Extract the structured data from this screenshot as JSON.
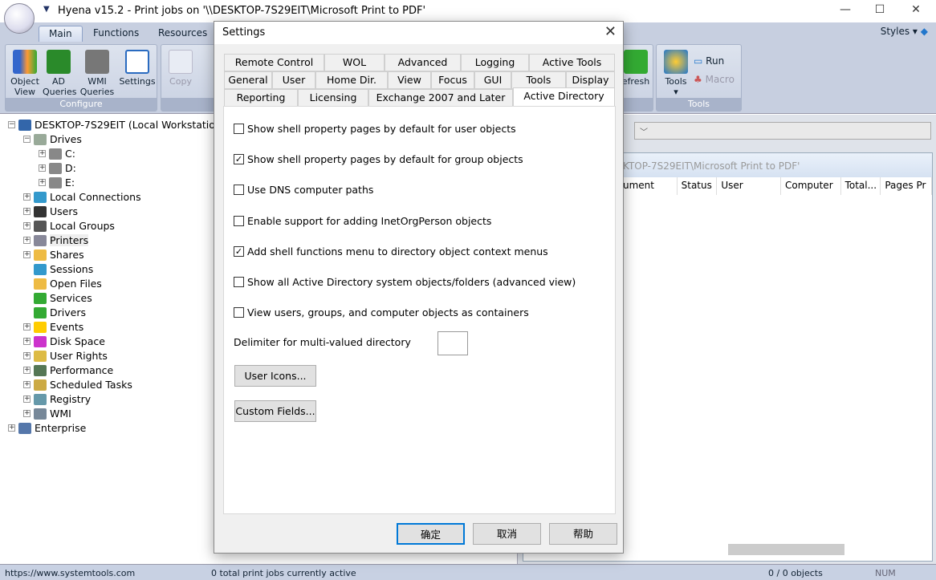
{
  "app": {
    "title": "Hyena v15.2 - Print jobs on '\\\\DESKTOP-7S29EIT\\Microsoft Print to PDF'",
    "styles_label": "Styles"
  },
  "ribbon": {
    "tabs": [
      "Main",
      "Functions",
      "Resources"
    ],
    "configure": {
      "label": "Configure",
      "buttons": [
        "Object View",
        "AD Queries",
        "WMI Queries",
        "Settings"
      ]
    },
    "copy_label": "Copy",
    "refresh_label": "efresh",
    "tools": {
      "label": "Tools",
      "tools_btn": "Tools",
      "run": "Run",
      "macro": "Macro"
    }
  },
  "tree": {
    "root": "DESKTOP-7S29EIT (Local Workstation)",
    "items": [
      {
        "label": "Drives",
        "level": 1,
        "exp": "-"
      },
      {
        "label": "C:",
        "level": 2,
        "exp": "+"
      },
      {
        "label": "D:",
        "level": 2,
        "exp": "+"
      },
      {
        "label": "E:",
        "level": 2,
        "exp": "+"
      },
      {
        "label": "Local Connections",
        "level": 1,
        "exp": "+"
      },
      {
        "label": "Users",
        "level": 1,
        "exp": "+"
      },
      {
        "label": "Local Groups",
        "level": 1,
        "exp": "+"
      },
      {
        "label": "Printers",
        "level": 1,
        "exp": "+"
      },
      {
        "label": "Shares",
        "level": 1,
        "exp": "+"
      },
      {
        "label": "Sessions",
        "level": 1,
        "exp": ""
      },
      {
        "label": "Open Files",
        "level": 1,
        "exp": ""
      },
      {
        "label": "Services",
        "level": 1,
        "exp": ""
      },
      {
        "label": "Drivers",
        "level": 1,
        "exp": ""
      },
      {
        "label": "Events",
        "level": 1,
        "exp": "+"
      },
      {
        "label": "Disk Space",
        "level": 1,
        "exp": "+"
      },
      {
        "label": "User Rights",
        "level": 1,
        "exp": "+"
      },
      {
        "label": "Performance",
        "level": 1,
        "exp": "+"
      },
      {
        "label": "Scheduled Tasks",
        "level": 1,
        "exp": "+"
      },
      {
        "label": "Registry",
        "level": 1,
        "exp": "+"
      },
      {
        "label": "WMI",
        "level": 1,
        "exp": "+"
      },
      {
        "label": "Enterprise",
        "level": 0,
        "exp": "+"
      }
    ]
  },
  "list": {
    "title": "KTOP-7S29EIT\\Microsoft Print to PDF'",
    "columns": [
      "ument",
      "Status",
      "User",
      "Computer",
      "Total...",
      "Pages Pr"
    ]
  },
  "status": {
    "url": "https://www.systemtools.com",
    "jobs": "0 total print jobs currently active",
    "objects": "0 / 0 objects",
    "num": "NUM"
  },
  "dialog": {
    "title": "Settings",
    "tabs_row1": [
      "Remote Control",
      "WOL",
      "Advanced",
      "Logging",
      "Active Tools"
    ],
    "tabs_row2": [
      "General",
      "User",
      "Home Dir.",
      "View",
      "Focus",
      "GUI",
      "Tools",
      "Display"
    ],
    "tabs_row3": [
      "Reporting",
      "Licensing",
      "Exchange 2007 and Later",
      "Active Directory"
    ],
    "options": [
      {
        "label": "Show shell property pages by default for user objects",
        "checked": false
      },
      {
        "label": "Show shell property pages by default for group objects",
        "checked": true
      },
      {
        "label": "Use DNS computer paths",
        "checked": false
      },
      {
        "label": "Enable support for adding InetOrgPerson objects",
        "checked": false
      },
      {
        "label": "Add shell functions menu to directory object context menus",
        "checked": true
      },
      {
        "label": "Show all Active Directory system objects/folders (advanced view)",
        "checked": false
      },
      {
        "label": "View users, groups, and computer objects as containers",
        "checked": false
      }
    ],
    "delimiter_label": "Delimiter for multi-valued directory",
    "delimiter_value": "",
    "user_icons": "User Icons...",
    "custom_fields": "Custom Fields...",
    "ok": "确定",
    "cancel": "取消",
    "help": "帮助"
  }
}
